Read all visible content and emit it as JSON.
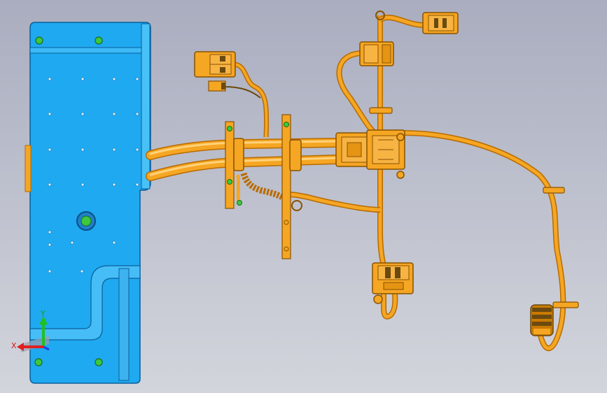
{
  "viewport": {
    "background_top": "#a9adbf",
    "background_bottom": "#d3d5dc"
  },
  "colors": {
    "plate_fill": "#1fa9f0",
    "plate_edge": "#0a5f9c",
    "harness_fill": "#f5a623",
    "harness_edge": "#b86b00",
    "harness_highlight": "#ffd27a",
    "marker_fill": "#3ec83e",
    "axis_x": "#e02020",
    "axis_y": "#20c020",
    "axis_z": "#2040e0"
  },
  "axis_triad": {
    "x_label": "X",
    "y_label": "Y"
  },
  "icons": {
    "triad": "coordinate-triad-icon",
    "marker": "green-dot-marker"
  }
}
